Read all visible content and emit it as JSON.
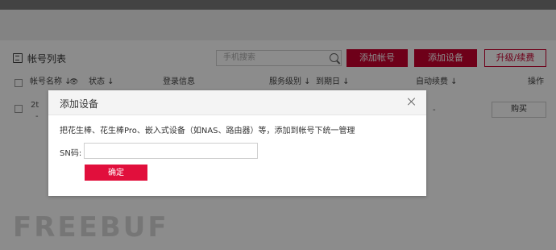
{
  "colors": {
    "accent_red": "#c8002f",
    "modal_button_red": "#e10f3c",
    "overlay": "rgba(0,0,0,0.45)"
  },
  "page": {
    "section_title": "帐号列表",
    "search_placeholder": "手机搜索",
    "buttons": {
      "add_account": "添加帐号",
      "add_device": "添加设备",
      "upgrade_renew": "升级/续费"
    },
    "table": {
      "headers": {
        "account_name": "帐号名称 ↓",
        "status": "状态 ↓",
        "login_info": "登录信息",
        "service_level": "服务级别 ↓",
        "expiry_date": "到期日 ↓",
        "auto_renew": "自动续费 ↓",
        "actions": "操作"
      },
      "row": {
        "account_partial": "2t",
        "dash": "-",
        "auto_renew_value": "-",
        "buy_label": "购买"
      }
    },
    "watermark": "FREEBUF"
  },
  "modal": {
    "title": "添加设备",
    "close_icon": "close-icon",
    "description": "把花生棒、花生棒Pro、嵌入式设备（如NAS、路由器）等，添加到帐号下统一管理",
    "sn_label": "SN码:",
    "sn_value": "",
    "confirm_label": "确定"
  }
}
